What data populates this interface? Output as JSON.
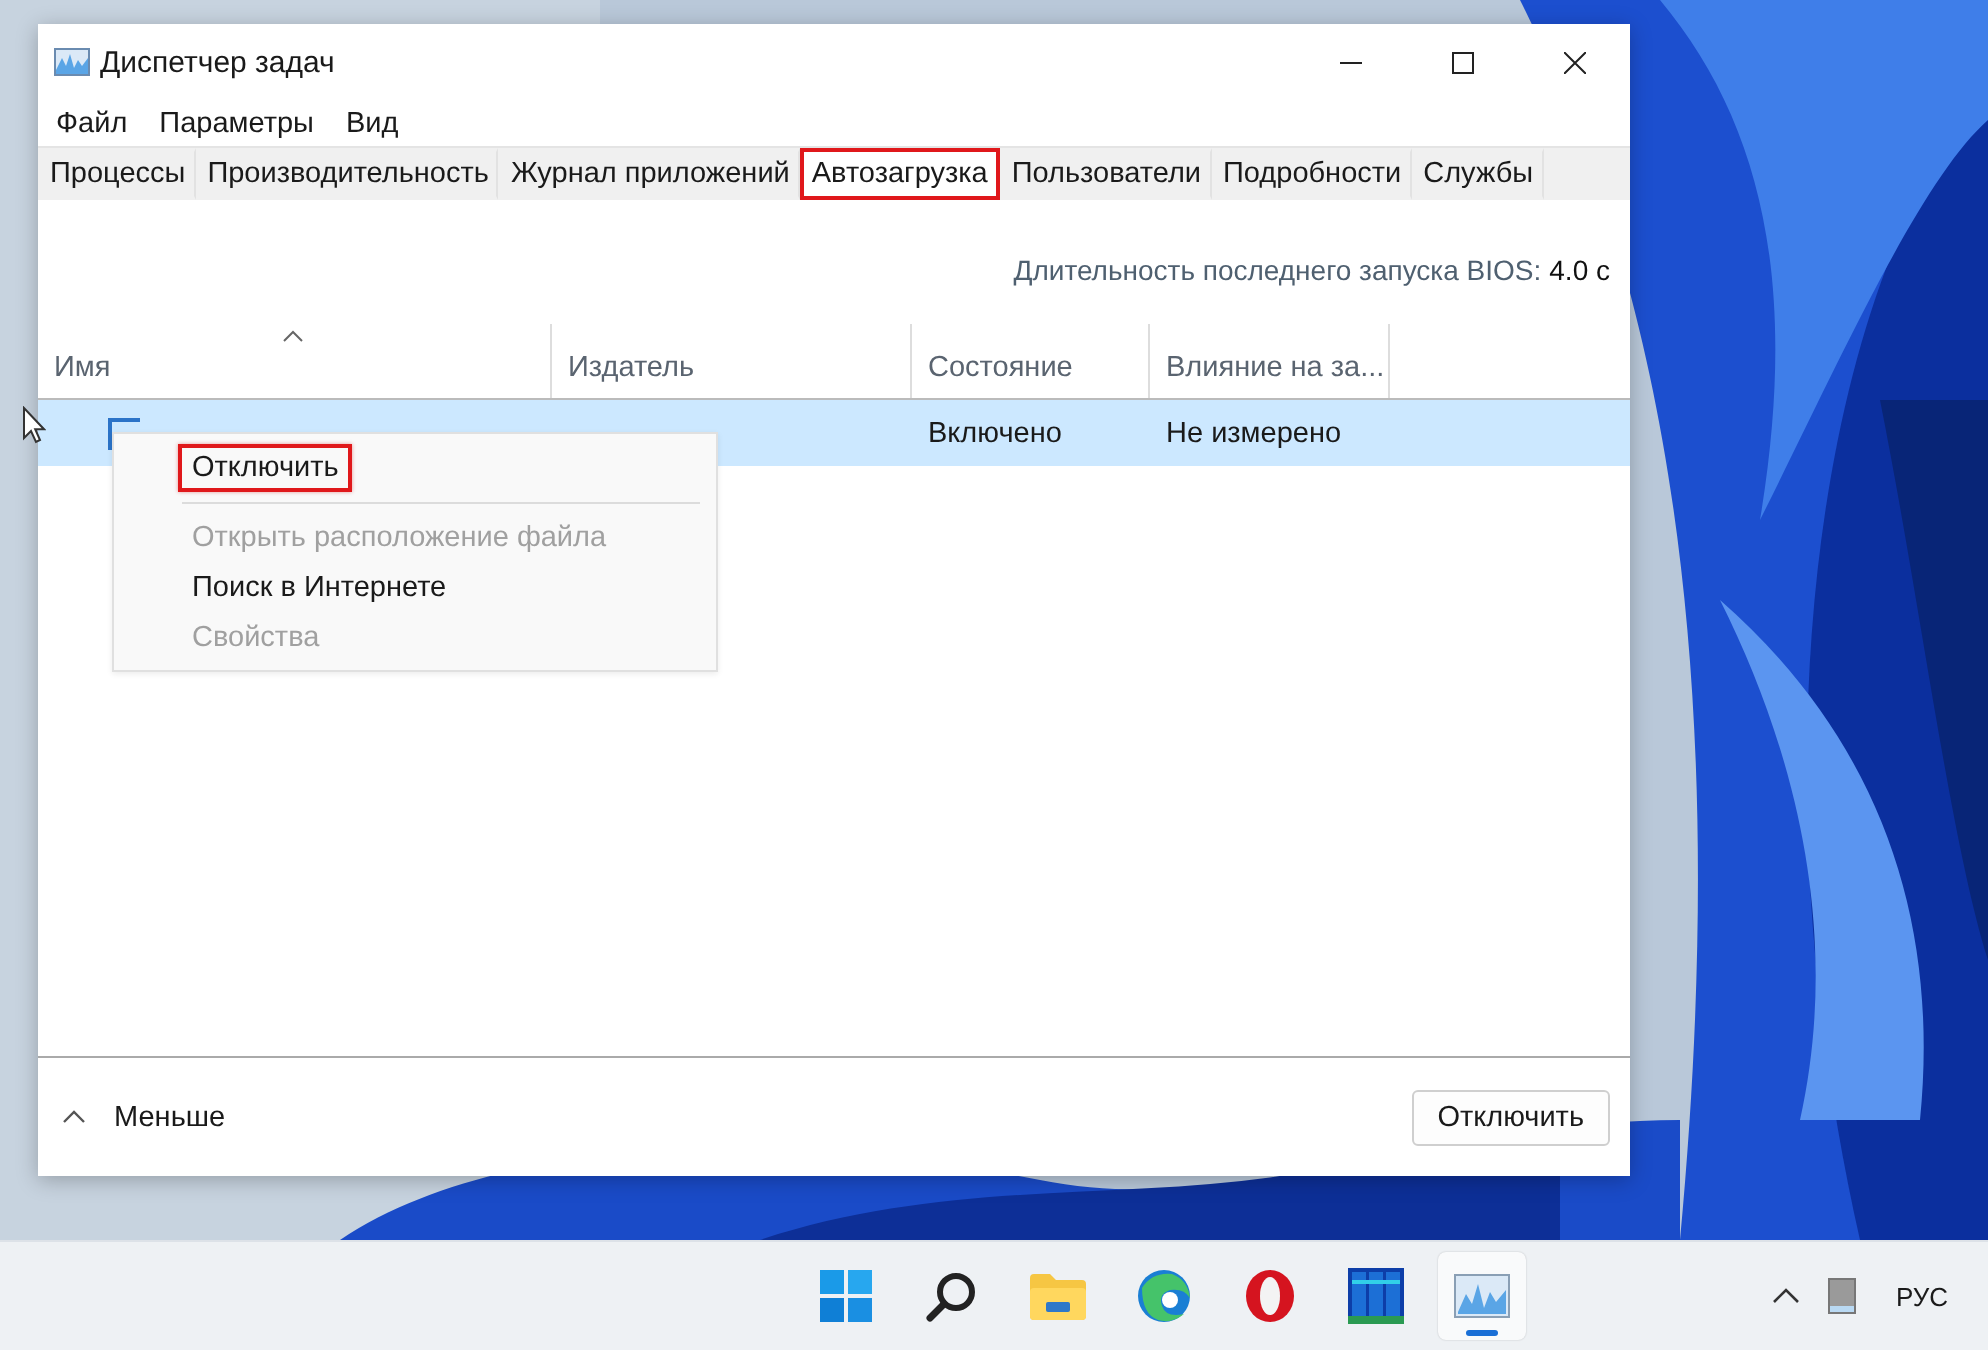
{
  "window": {
    "title": "Диспетчер задач"
  },
  "menu": [
    "Файл",
    "Параметры",
    "Вид"
  ],
  "tabs": [
    {
      "label": "Процессы",
      "selected": false,
      "highlighted": false
    },
    {
      "label": "Производительность",
      "selected": false,
      "highlighted": false
    },
    {
      "label": "Журнал приложений",
      "selected": false,
      "highlighted": false
    },
    {
      "label": "Автозагрузка",
      "selected": true,
      "highlighted": true
    },
    {
      "label": "Пользователи",
      "selected": false,
      "highlighted": false
    },
    {
      "label": "Подробности",
      "selected": false,
      "highlighted": false
    },
    {
      "label": "Службы",
      "selected": false,
      "highlighted": false
    }
  ],
  "bios": {
    "label": "Длительность последнего запуска BIOS:",
    "value": "4.0 с"
  },
  "table": {
    "columns": [
      {
        "label": "Имя",
        "sorted": true
      },
      {
        "label": "Издатель",
        "sorted": false
      },
      {
        "label": "Состояние",
        "sorted": false
      },
      {
        "label": "Влияние на за...",
        "sorted": false
      }
    ],
    "rows": [
      {
        "selected": true,
        "status": "Включено",
        "impact": "Не измерено"
      }
    ]
  },
  "context_menu": {
    "items": [
      {
        "label": "Отключить",
        "disabled": false,
        "highlighted": true,
        "separator_after": true
      },
      {
        "label": "Открыть расположение файла",
        "disabled": true,
        "highlighted": false,
        "separator_after": false
      },
      {
        "label": "Поиск в Интернете",
        "disabled": false,
        "highlighted": false,
        "separator_after": false
      },
      {
        "label": "Свойства",
        "disabled": true,
        "highlighted": false,
        "separator_after": false
      }
    ]
  },
  "footer": {
    "toggle": "Меньше",
    "button": "Отключить"
  },
  "taskbar": {
    "apps": [
      {
        "kind": "start",
        "active": false
      },
      {
        "kind": "search",
        "active": false
      },
      {
        "kind": "folder",
        "active": false
      },
      {
        "kind": "browser",
        "active": false
      },
      {
        "kind": "ring",
        "active": false
      },
      {
        "kind": "meter",
        "active": false
      },
      {
        "kind": "chart",
        "active": true
      }
    ],
    "language": "РУС"
  }
}
